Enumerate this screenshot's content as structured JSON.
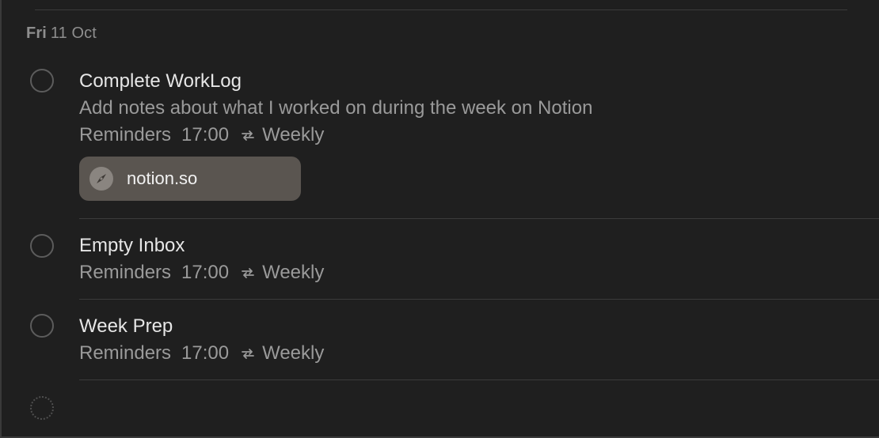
{
  "section": {
    "day_of_week": "Fri",
    "date": "11 Oct"
  },
  "reminders": [
    {
      "title": "Complete WorkLog",
      "notes": "Add notes about what I worked on during the week on Notion",
      "list": "Reminders",
      "time": "17:00",
      "repeat": "Weekly",
      "link": {
        "label": "notion.so",
        "icon": "compass-icon"
      }
    },
    {
      "title": "Empty Inbox",
      "list": "Reminders",
      "time": "17:00",
      "repeat": "Weekly"
    },
    {
      "title": "Week Prep",
      "list": "Reminders",
      "time": "17:00",
      "repeat": "Weekly"
    }
  ],
  "icons": {
    "repeat": "repeat-icon",
    "new_item": "dotted-circle-icon"
  },
  "colors": {
    "background": "#1f1f1f",
    "title_text": "#e6e6e6",
    "secondary_text": "#9a9a9a",
    "link_chip": "#5a5550"
  }
}
